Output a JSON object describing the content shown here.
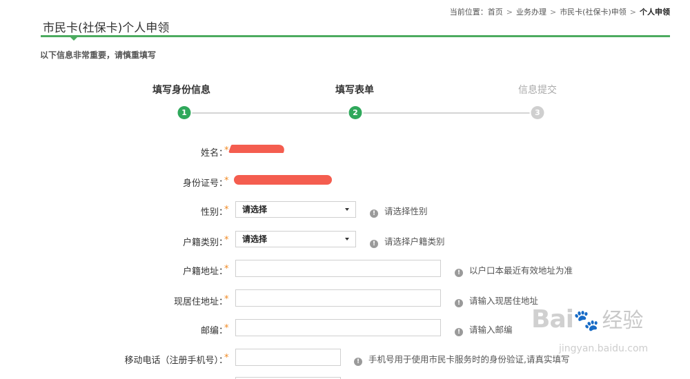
{
  "breadcrumb": {
    "prefix": "当前位置：",
    "items": [
      "首页",
      "业务办理",
      "市民卡(社保卡)申领"
    ],
    "current": "个人申领",
    "separator": ">"
  },
  "page_title": "市民卡(社保卡)个人申领",
  "notice": "以下信息非常重要，请慎重填写",
  "steps": [
    {
      "label": "填写身份信息",
      "number": "1",
      "state": "done"
    },
    {
      "label": "填写表单",
      "number": "2",
      "state": "active"
    },
    {
      "label": "信息提交",
      "number": "3",
      "state": "pending"
    }
  ],
  "required_mark": "*",
  "form": {
    "name": {
      "label": "姓名："
    },
    "id_number": {
      "label": "身份证号："
    },
    "gender": {
      "label": "性别：",
      "selected": "请选择",
      "hint": "请选择性别"
    },
    "household_type": {
      "label": "户籍类别：",
      "selected": "请选择",
      "hint": "请选择户籍类别"
    },
    "household_address": {
      "label": "户籍地址：",
      "value": "",
      "hint": "以户口本最近有效地址为准"
    },
    "current_address": {
      "label": "现居住地址：",
      "value": "",
      "hint": "请输入现居住地址"
    },
    "postcode": {
      "label": "邮编：",
      "value": "",
      "hint": "请输入邮编"
    },
    "mobile": {
      "label": "移动电话（注册手机号）：",
      "value": "",
      "hint": "手机号用于使用市民卡服务时的身份验证,请真实填写"
    }
  },
  "watermark": {
    "brand": "Bai",
    "brand_tail": "经验",
    "url": "jingyan.baidu.com"
  },
  "colors": {
    "accent": "#4cab5f",
    "step_active": "#2fa85b",
    "step_inactive": "#cfcfcf",
    "required": "#f08a24"
  }
}
